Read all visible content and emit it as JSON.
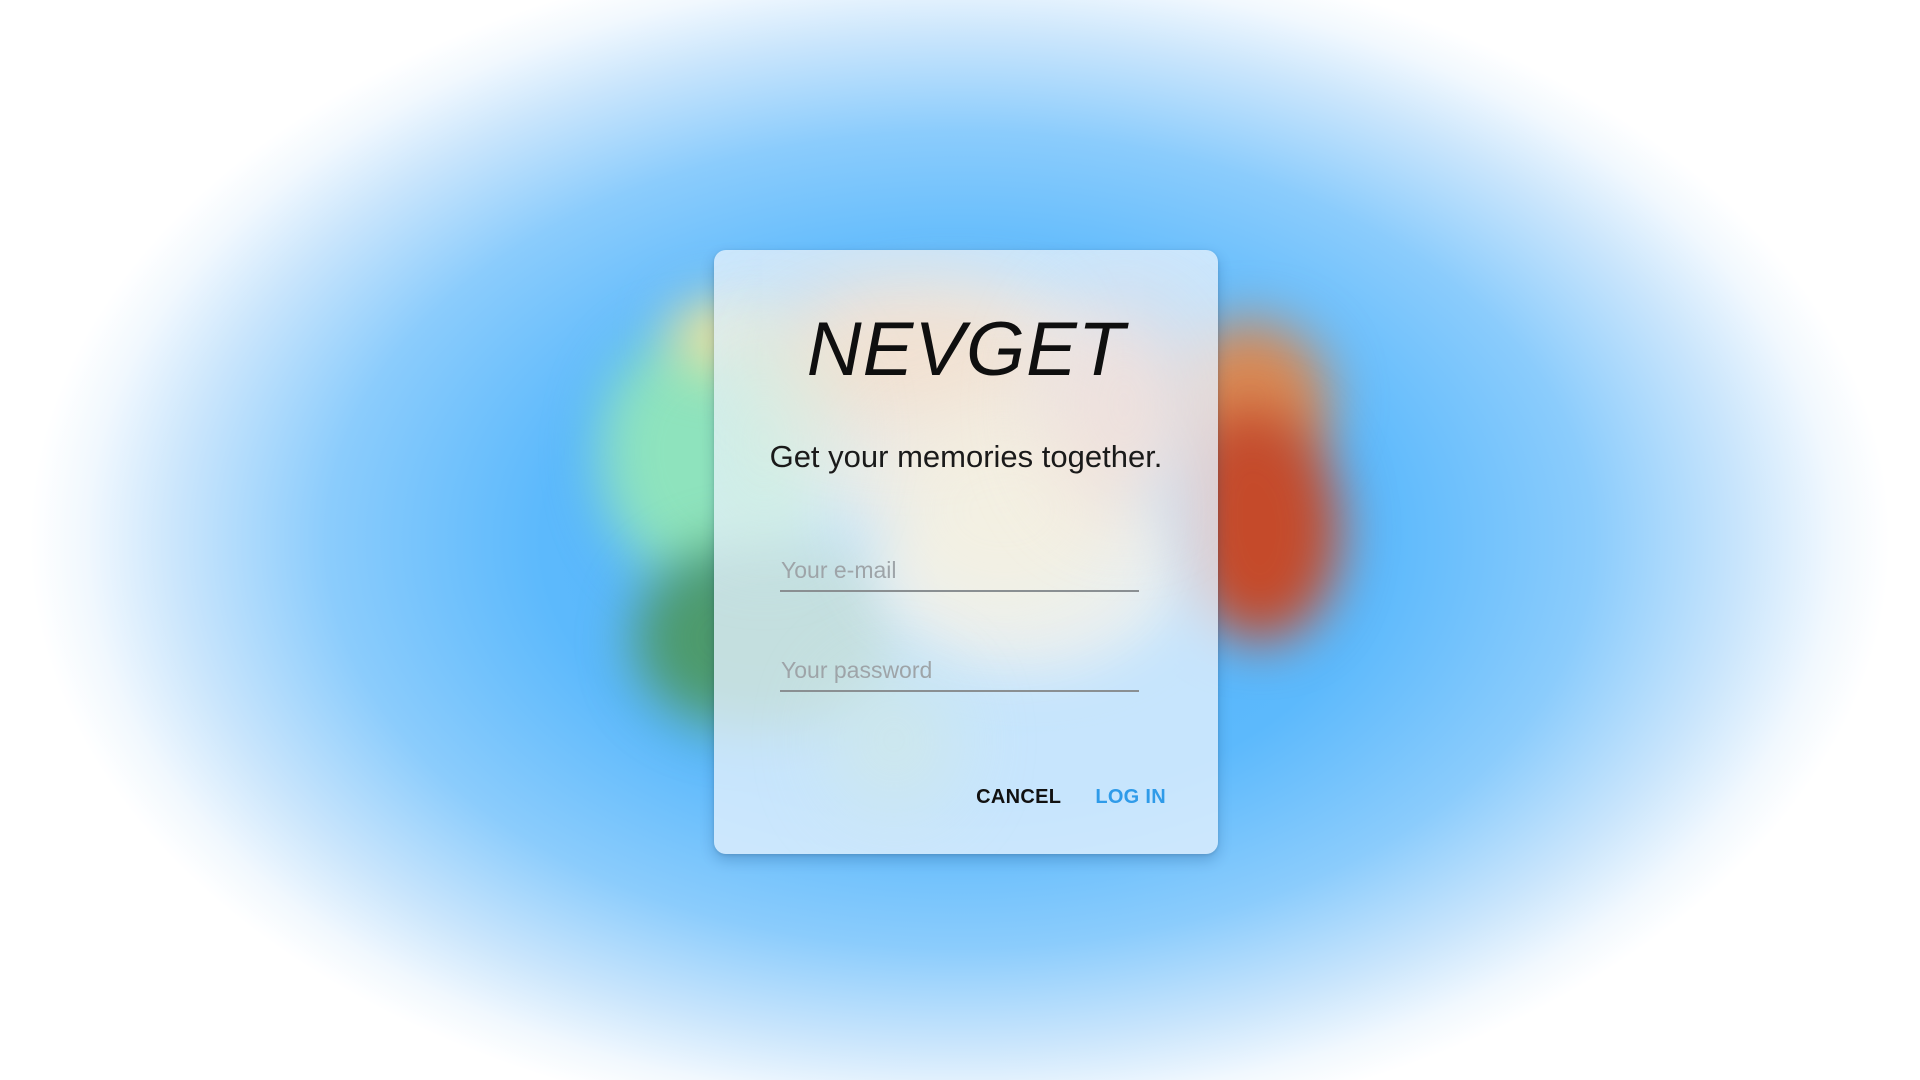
{
  "app": {
    "title": "NEVGET",
    "tagline": "Get your memories together."
  },
  "form": {
    "email": {
      "value": "",
      "placeholder": "Your e-mail"
    },
    "password": {
      "value": "",
      "placeholder": "Your password"
    }
  },
  "actions": {
    "cancel_label": "CANCEL",
    "login_label": "LOG IN"
  },
  "colors": {
    "background_accent": "#4fb3fb",
    "primary_button": "#2f9be9",
    "card_background": "#e2f0fc"
  }
}
